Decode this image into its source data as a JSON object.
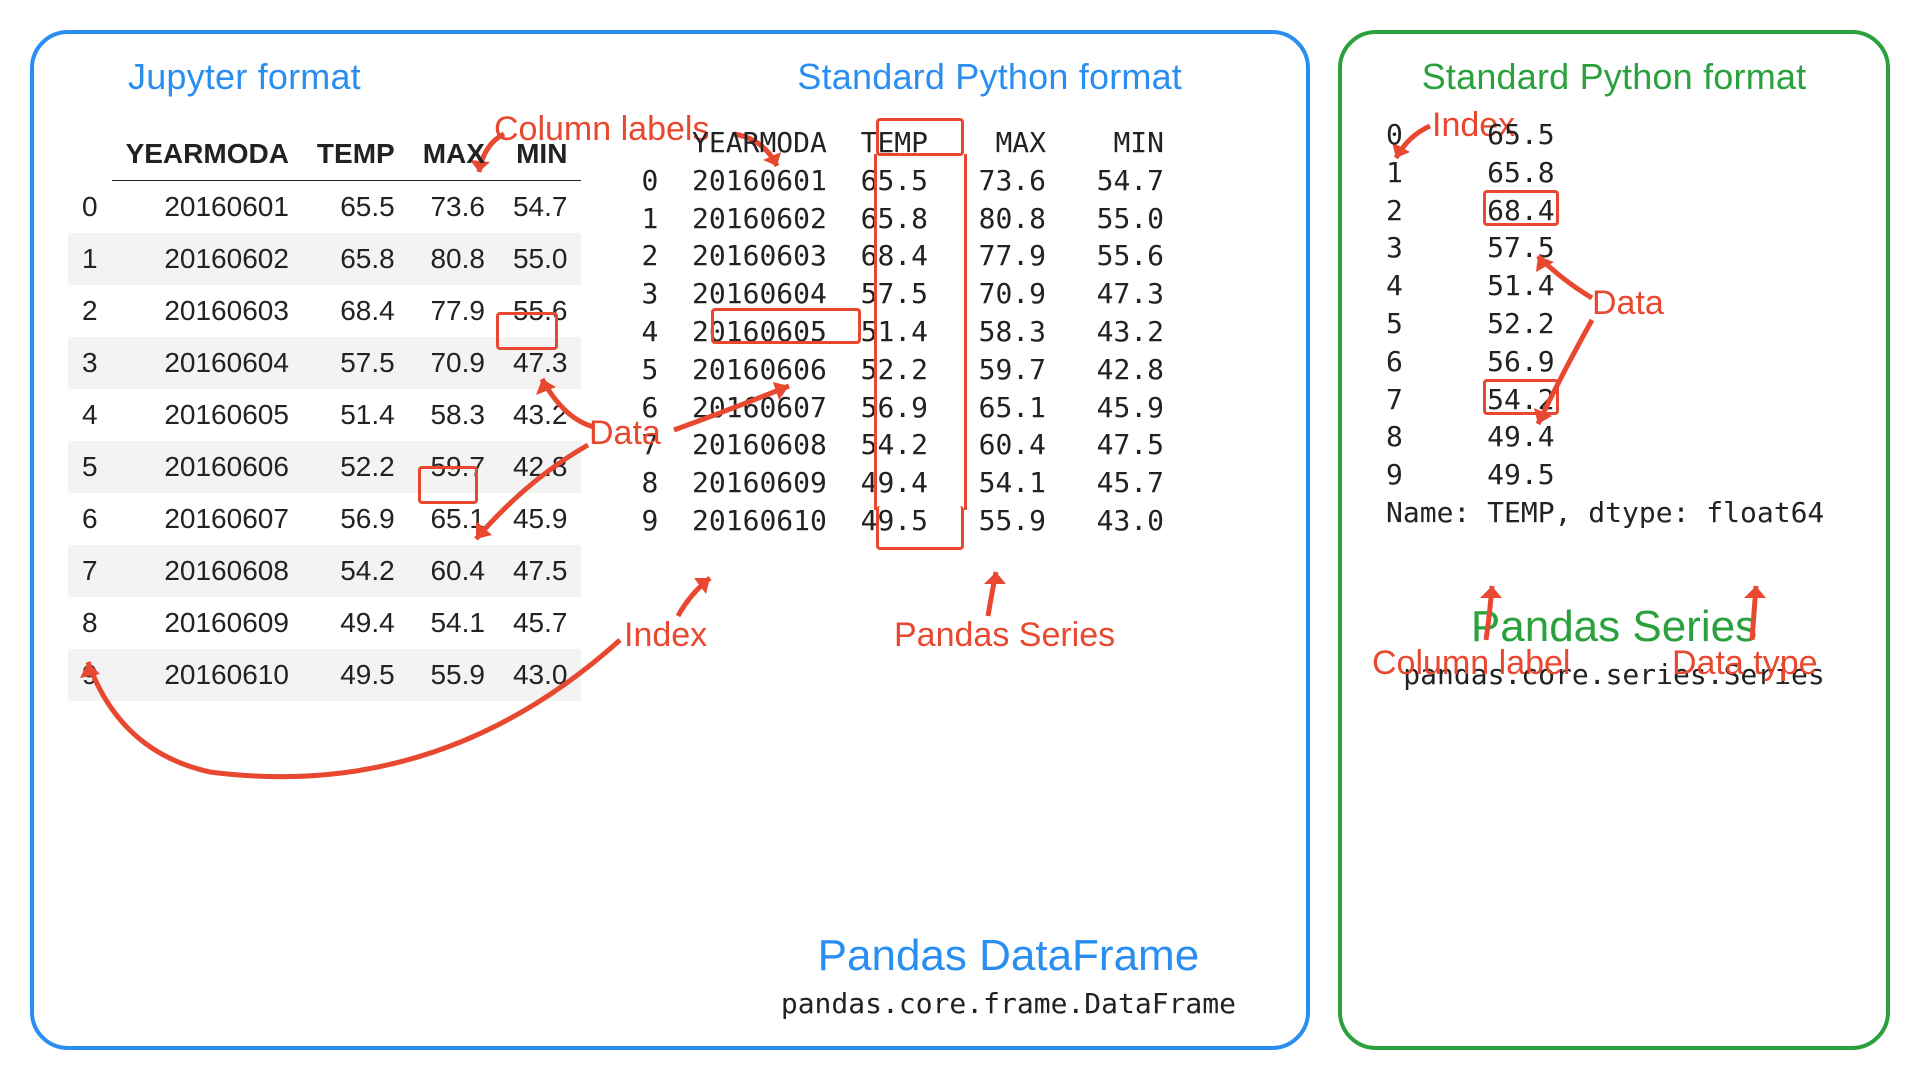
{
  "dataframe_panel": {
    "heading_jupyter": "Jupyter format",
    "heading_standard": "Standard Python format",
    "title": "Pandas DataFrame",
    "class_path": "pandas.core.frame.DataFrame",
    "columns": [
      "YEARMODA",
      "TEMP",
      "MAX",
      "MIN"
    ],
    "rows": [
      {
        "idx": 0,
        "YEARMODA": "20160601",
        "TEMP": "65.5",
        "MAX": "73.6",
        "MIN": "54.7"
      },
      {
        "idx": 1,
        "YEARMODA": "20160602",
        "TEMP": "65.8",
        "MAX": "80.8",
        "MIN": "55.0"
      },
      {
        "idx": 2,
        "YEARMODA": "20160603",
        "TEMP": "68.4",
        "MAX": "77.9",
        "MIN": "55.6"
      },
      {
        "idx": 3,
        "YEARMODA": "20160604",
        "TEMP": "57.5",
        "MAX": "70.9",
        "MIN": "47.3"
      },
      {
        "idx": 4,
        "YEARMODA": "20160605",
        "TEMP": "51.4",
        "MAX": "58.3",
        "MIN": "43.2"
      },
      {
        "idx": 5,
        "YEARMODA": "20160606",
        "TEMP": "52.2",
        "MAX": "59.7",
        "MIN": "42.8"
      },
      {
        "idx": 6,
        "YEARMODA": "20160607",
        "TEMP": "56.9",
        "MAX": "65.1",
        "MIN": "45.9"
      },
      {
        "idx": 7,
        "YEARMODA": "20160608",
        "TEMP": "54.2",
        "MAX": "60.4",
        "MIN": "47.5"
      },
      {
        "idx": 8,
        "YEARMODA": "20160609",
        "TEMP": "49.4",
        "MAX": "54.1",
        "MIN": "45.7"
      },
      {
        "idx": 9,
        "YEARMODA": "20160610",
        "TEMP": "49.5",
        "MAX": "55.9",
        "MIN": "43.0"
      }
    ],
    "annot_column_labels": "Column labels",
    "annot_data": "Data",
    "annot_index": "Index",
    "annot_pandas_series": "Pandas Series"
  },
  "series_panel": {
    "heading": "Standard Python format",
    "title": "Pandas Series",
    "class_path": "pandas.core.series.Series",
    "values": [
      {
        "idx": 0,
        "v": "65.5"
      },
      {
        "idx": 1,
        "v": "65.8"
      },
      {
        "idx": 2,
        "v": "68.4"
      },
      {
        "idx": 3,
        "v": "57.5"
      },
      {
        "idx": 4,
        "v": "51.4"
      },
      {
        "idx": 5,
        "v": "52.2"
      },
      {
        "idx": 6,
        "v": "56.9"
      },
      {
        "idx": 7,
        "v": "54.2"
      },
      {
        "idx": 8,
        "v": "49.4"
      },
      {
        "idx": 9,
        "v": "49.5"
      }
    ],
    "meta_line": "Name: TEMP, dtype: float64",
    "annot_index": "Index",
    "annot_data": "Data",
    "annot_column_label": "Column label",
    "annot_data_type": "Data type"
  }
}
